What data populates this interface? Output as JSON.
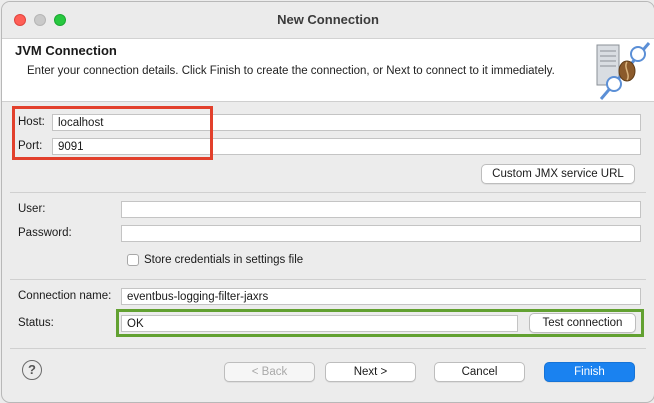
{
  "window": {
    "title": "New Connection"
  },
  "banner": {
    "title": "JVM Connection",
    "description": "Enter your connection details. Click Finish to create the connection, or Next to connect to it immediately.",
    "icon": "jvm-connection-icon"
  },
  "form": {
    "host_label": "Host:",
    "host_value": "localhost",
    "port_label": "Port:",
    "port_value": "9091",
    "custom_jmx_button": "Custom JMX service URL",
    "user_label": "User:",
    "user_value": "",
    "password_label": "Password:",
    "password_value": "",
    "store_credentials_label": "Store credentials in settings file",
    "store_credentials_checked": false,
    "connection_name_label": "Connection name:",
    "connection_name_value": "eventbus-logging-filter-jaxrs",
    "status_label": "Status:",
    "status_value": "OK",
    "test_connection_button": "Test connection"
  },
  "footer": {
    "help_icon": "?",
    "back_button": "< Back",
    "next_button": "Next >",
    "cancel_button": "Cancel",
    "finish_button": "Finish"
  },
  "colors": {
    "highlight_red": "#e2402c",
    "highlight_green": "#62a131",
    "primary_button": "#1a82f0"
  }
}
